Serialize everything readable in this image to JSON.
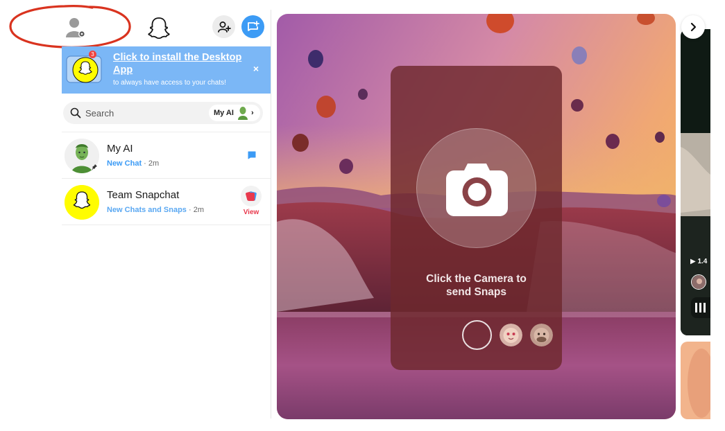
{
  "sidebar": {
    "banner": {
      "badge_count": "3",
      "title": "Click to install the Desktop App",
      "subtitle": "to always have access to your chats!",
      "close_label": "×"
    },
    "search": {
      "placeholder": "Search",
      "myai_label": "My AI",
      "chevron": "›"
    },
    "chats": [
      {
        "name": "My AI",
        "status": "New Chat",
        "time": "2m",
        "separator": " · "
      },
      {
        "name": "Team Snapchat",
        "status": "New Chats and Snaps",
        "time": "2m",
        "separator": " · ",
        "action_label": "View"
      }
    ]
  },
  "camera": {
    "caption_line1": "Click the Camera to",
    "caption_line2": "send Snaps"
  },
  "spotlight": {
    "views_label": "▶ 1.4",
    "next_chevron": "›"
  },
  "colors": {
    "accent_blue": "#3c9bf5",
    "banner_blue": "#7bb7f6",
    "snap_yellow": "#fffc00",
    "view_red": "#e8394d",
    "annotation_red": "#d9331f"
  }
}
